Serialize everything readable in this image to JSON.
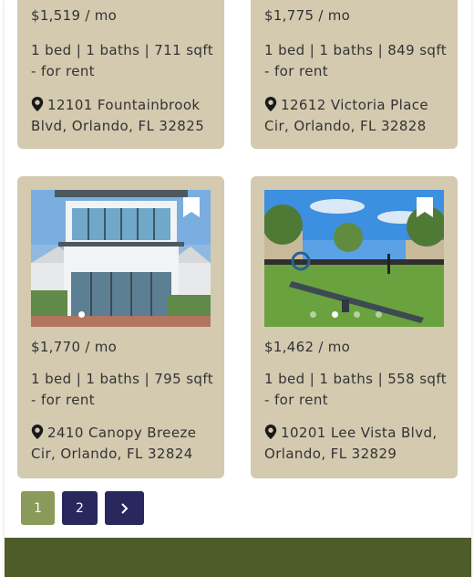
{
  "listings": [
    {
      "price": "$1,519 / mo",
      "details": "1 bed | 1 baths | 711 sqft - for rent",
      "address": "12101 Fountainbrook Blvd, Orlando, FL 32825"
    },
    {
      "price": "$1,775 / mo",
      "details": "1 bed | 1 baths | 849 sqft - for rent",
      "address": "12612 Victoria Place Cir, Orlando, FL 32828"
    },
    {
      "price": "$1,770 / mo",
      "details": "1 bed | 1 baths | 795 sqft - for rent",
      "address": "2410 Canopy Breeze Cir, Orlando, FL 32824"
    },
    {
      "price": "$1,462 / mo",
      "details": "1 bed | 1 baths | 558 sqft - for rent",
      "address": "10201 Lee Vista Blvd, Orlando, FL 32829"
    }
  ],
  "pagination": {
    "pages": [
      "1",
      "2"
    ],
    "current": "1",
    "next_icon": "chevron-right-icon"
  },
  "colors": {
    "card_bg": "#d3cab0",
    "page_active": "#8a9a5b",
    "page_inactive": "#28285e",
    "footer": "#4d5c28"
  }
}
